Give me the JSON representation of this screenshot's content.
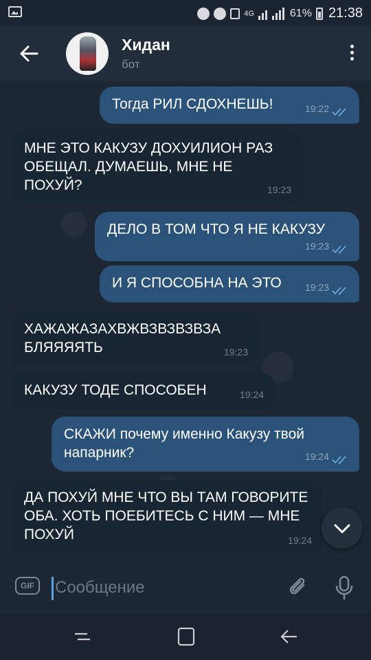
{
  "status_bar": {
    "network": "4G",
    "battery": "61%",
    "time": "21:38"
  },
  "header": {
    "title": "Хидан",
    "subtitle": "бот"
  },
  "messages": [
    {
      "dir": "out",
      "text": "Тогда РИЛ СДОХНЕШЬ!",
      "time": "19:22"
    },
    {
      "dir": "in",
      "text": "МНЕ ЭТО КАКУЗУ ДОХУИЛИОН РАЗ ОБЕЩАЛ. ДУМАЕШЬ, МНЕ НЕ ПОХУЙ?",
      "time": "19:23"
    },
    {
      "dir": "out",
      "text": "ДЕЛО В ТОМ ЧТО Я НЕ КАКУЗУ",
      "time": "19:23"
    },
    {
      "dir": "out",
      "text": "И Я СПОСОБНА НА ЭТО",
      "time": "19:23"
    },
    {
      "dir": "in",
      "text": "ХАЖАЖАЗАХВЖВЗВЗВЗВЗА БЛЯЯЯЯТЬ",
      "time": "19:23"
    },
    {
      "dir": "in",
      "text": "КАКУЗУ ТОДЕ СПОСОБЕН",
      "time": "19:24"
    },
    {
      "dir": "out",
      "text": "СКАЖИ почему именно Какузу твой напарник?",
      "time": "19:24"
    },
    {
      "dir": "in",
      "text": "ДА ПОХУЙ МНЕ ЧТО ВЫ ТАМ ГОВОРИТЕ ОБА. ХОТЬ ПОЕБИТЕСЬ С НИМ — МНЕ ПОХУЙ",
      "time": "19:24"
    }
  ],
  "input": {
    "gif_label": "GIF",
    "placeholder": "Сообщение"
  },
  "colors": {
    "outgoing_bubble": "#2b5278",
    "incoming_bubble": "#182533",
    "background": "#1d2733",
    "accent": "#5fa3de"
  }
}
